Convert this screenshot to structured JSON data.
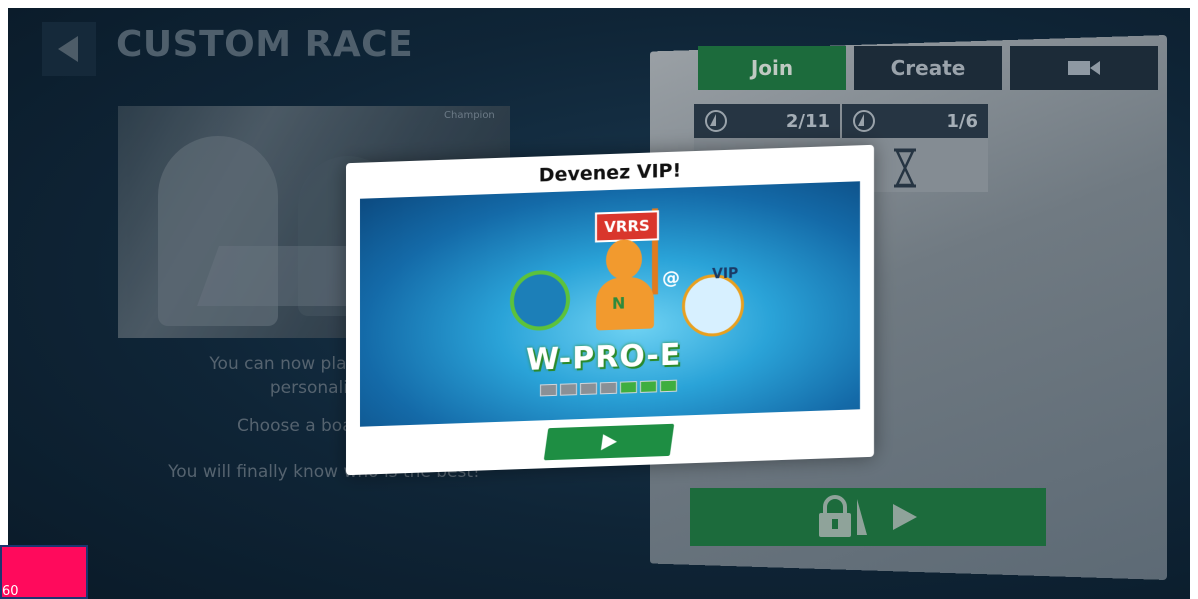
{
  "header": {
    "title": "CUSTOM RACE"
  },
  "left": {
    "photo_caption": "Champion",
    "lines": [
      "You can now play with frier",
      "personalized",
      "Choose a boat and s",
      "You will finally know who is the best!"
    ]
  },
  "tabs": [
    {
      "label": "Join",
      "active": true
    },
    {
      "label": "Create",
      "active": false
    },
    {
      "label": "",
      "icon": "video-camera-icon",
      "active": false
    }
  ],
  "rooms": [
    {
      "count": "2/11",
      "icon": "boat-badge-icon"
    },
    {
      "count": "1/6",
      "icon": "boat-badge-icon"
    }
  ],
  "modal": {
    "title": "Devenez VIP!",
    "image": {
      "flag": "VRRS",
      "shirt": "N",
      "at": "@",
      "vip": "VIP",
      "pro": "W-PRO-E",
      "levels_total": 7,
      "levels_filled": 3
    },
    "play_icon": "play-icon"
  },
  "overlay": {
    "corner_text": "60"
  },
  "colors": {
    "accent_green": "#1c6b3c",
    "modal_play_green": "#1e8e43",
    "flag_red": "#d9362c",
    "pink": "#ff0a5c"
  }
}
